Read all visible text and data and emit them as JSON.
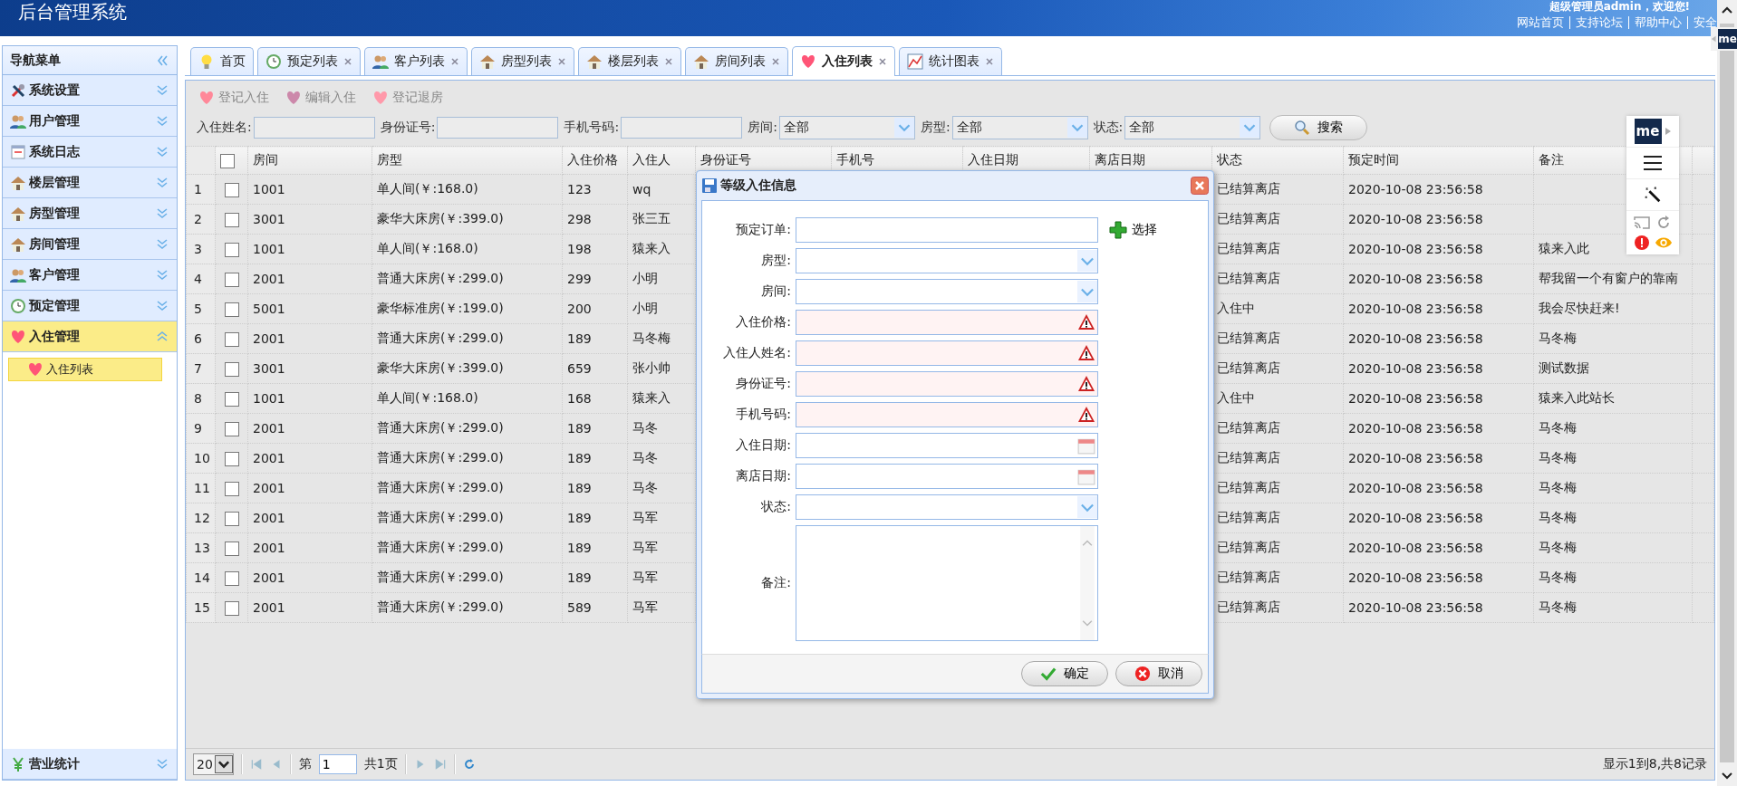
{
  "header": {
    "title": "后台管理系统",
    "welcome": "超级管理员admin，欢迎您!",
    "links": [
      "网站首页",
      "支持论坛",
      "帮助中心",
      "安全"
    ]
  },
  "sidebar": {
    "title": "导航菜单",
    "items": [
      {
        "label": "系统设置",
        "expanded": false
      },
      {
        "label": "用户管理",
        "expanded": false
      },
      {
        "label": "系统日志",
        "expanded": false
      },
      {
        "label": "楼层管理",
        "expanded": false
      },
      {
        "label": "房型管理",
        "expanded": false
      },
      {
        "label": "房间管理",
        "expanded": false
      },
      {
        "label": "客户管理",
        "expanded": false
      },
      {
        "label": "预定管理",
        "expanded": false
      },
      {
        "label": "入住管理",
        "expanded": true,
        "children": [
          {
            "label": "入住列表",
            "selected": true
          }
        ]
      }
    ],
    "bottom_item": {
      "label": "营业统计",
      "expanded": false
    }
  },
  "tabs": [
    {
      "label": "首页",
      "closable": false,
      "selected": false
    },
    {
      "label": "预定列表",
      "closable": true,
      "selected": false
    },
    {
      "label": "客户列表",
      "closable": true,
      "selected": false
    },
    {
      "label": "房型列表",
      "closable": true,
      "selected": false
    },
    {
      "label": "楼层列表",
      "closable": true,
      "selected": false
    },
    {
      "label": "房间列表",
      "closable": true,
      "selected": false
    },
    {
      "label": "入住列表",
      "closable": true,
      "selected": true
    },
    {
      "label": "统计图表",
      "closable": true,
      "selected": false
    }
  ],
  "toolbar": [
    {
      "label": "登记入住",
      "disabled": true
    },
    {
      "label": "编辑入住",
      "disabled": true
    },
    {
      "label": "登记退房",
      "disabled": true
    }
  ],
  "search": {
    "fields": [
      {
        "label": "入住姓名:",
        "kind": "text"
      },
      {
        "label": "身份证号:",
        "kind": "text"
      },
      {
        "label": "手机号码:",
        "kind": "text"
      },
      {
        "label": "房间:",
        "kind": "select",
        "value": "全部"
      },
      {
        "label": "房型:",
        "kind": "select",
        "value": "全部"
      },
      {
        "label": "状态:",
        "kind": "select",
        "value": "全部"
      }
    ],
    "button": "搜索"
  },
  "table": {
    "header_checked": false,
    "columns": [
      "房间",
      "房型",
      "入住价格",
      "入住人",
      "身份证号",
      "手机号",
      "入住日期",
      "离店日期",
      "状态",
      "预定时间",
      "备注"
    ],
    "rows": [
      {
        "number": "1",
        "checked": false,
        "cells": [
          "1001",
          "单人间(￥:168.0)",
          "123",
          "wq",
          "",
          "",
          "",
          "",
          "已结算离店",
          "2020-10-08 23:56:58",
          ""
        ]
      },
      {
        "number": "2",
        "checked": false,
        "cells": [
          "3001",
          "豪华大床房(￥:399.0)",
          "298",
          "张三五",
          "",
          "",
          "",
          "",
          "已结算离店",
          "2020-10-08 23:56:58",
          ""
        ]
      },
      {
        "number": "3",
        "checked": false,
        "cells": [
          "1001",
          "单人间(￥:168.0)",
          "198",
          "猿来入",
          "",
          "",
          "",
          "",
          "已结算离店",
          "2020-10-08 23:56:58",
          "猿来入此"
        ]
      },
      {
        "number": "4",
        "checked": false,
        "cells": [
          "2001",
          "普通大床房(￥:299.0)",
          "299",
          "小明",
          "",
          "",
          "",
          "",
          "已结算离店",
          "2020-10-08 23:56:58",
          "帮我留一个有窗户的靠南"
        ]
      },
      {
        "number": "5",
        "checked": false,
        "cells": [
          "5001",
          "豪华标准房(￥:199.0)",
          "200",
          "小明",
          "",
          "",
          "",
          "",
          "入住中",
          "2020-10-08 23:56:58",
          "我会尽快赶来!"
        ]
      },
      {
        "number": "6",
        "checked": false,
        "cells": [
          "2001",
          "普通大床房(￥:299.0)",
          "189",
          "马冬梅",
          "",
          "",
          "",
          "",
          "已结算离店",
          "2020-10-08 23:56:58",
          "马冬梅"
        ]
      },
      {
        "number": "7",
        "checked": false,
        "cells": [
          "3001",
          "豪华大床房(￥:399.0)",
          "659",
          "张小帅",
          "",
          "",
          "",
          "",
          "已结算离店",
          "2020-10-08 23:56:58",
          "测试数据"
        ]
      },
      {
        "number": "8",
        "checked": false,
        "cells": [
          "1001",
          "单人间(￥:168.0)",
          "168",
          "猿来入",
          "",
          "",
          "",
          "",
          "入住中",
          "2020-10-08 23:56:58",
          "猿来入此站长"
        ]
      },
      {
        "number": "9",
        "checked": false,
        "cells": [
          "2001",
          "普通大床房(￥:299.0)",
          "189",
          "马冬",
          "",
          "",
          "",
          "",
          "已结算离店",
          "2020-10-08 23:56:58",
          "马冬梅"
        ]
      },
      {
        "number": "10",
        "checked": false,
        "cells": [
          "2001",
          "普通大床房(￥:299.0)",
          "189",
          "马冬",
          "",
          "",
          "",
          "",
          "已结算离店",
          "2020-10-08 23:56:58",
          "马冬梅"
        ]
      },
      {
        "number": "11",
        "checked": false,
        "cells": [
          "2001",
          "普通大床房(￥:299.0)",
          "189",
          "马冬",
          "",
          "",
          "",
          "",
          "已结算离店",
          "2020-10-08 23:56:58",
          "马冬梅"
        ]
      },
      {
        "number": "12",
        "checked": false,
        "cells": [
          "2001",
          "普通大床房(￥:299.0)",
          "189",
          "马军",
          "",
          "",
          "",
          "",
          "已结算离店",
          "2020-10-08 23:56:58",
          "马冬梅"
        ]
      },
      {
        "number": "13",
        "checked": false,
        "cells": [
          "2001",
          "普通大床房(￥:299.0)",
          "189",
          "马军",
          "",
          "",
          "",
          "",
          "已结算离店",
          "2020-10-08 23:56:58",
          "马冬梅"
        ]
      },
      {
        "number": "14",
        "checked": false,
        "cells": [
          "2001",
          "普通大床房(￥:299.0)",
          "189",
          "马军",
          "",
          "",
          "",
          "",
          "已结算离店",
          "2020-10-08 23:56:58",
          "马冬梅"
        ]
      },
      {
        "number": "15",
        "checked": false,
        "cells": [
          "2001",
          "普通大床房(￥:299.0)",
          "589",
          "马军",
          "",
          "",
          "",
          "",
          "已结算离店",
          "2020-10-08 23:56:58",
          "马冬梅"
        ]
      }
    ]
  },
  "pagination": {
    "page_size": "20",
    "page_prefix": "第",
    "page": "1",
    "page_suffix": "共1页",
    "summary": "显示1到8,共8记录"
  },
  "dialog": {
    "title": "等级入住信息",
    "fields": [
      {
        "label": "预定订单:",
        "kind": "text"
      },
      {
        "label": "房型:",
        "kind": "select"
      },
      {
        "label": "房间:",
        "kind": "select"
      },
      {
        "label": "入住价格:",
        "kind": "required"
      },
      {
        "label": "入住人姓名:",
        "kind": "required"
      },
      {
        "label": "身份证号:",
        "kind": "required"
      },
      {
        "label": "手机号码:",
        "kind": "required"
      },
      {
        "label": "入住日期:",
        "kind": "date"
      },
      {
        "label": "离店日期:",
        "kind": "date"
      },
      {
        "label": "状态:",
        "kind": "select"
      },
      {
        "label": "备注:",
        "kind": "textarea"
      }
    ],
    "pick_button": "选择",
    "ok_button": "确定",
    "cancel_button": "取消"
  },
  "extension": {
    "logo": "me"
  },
  "extension_tab": {
    "logo": "me"
  }
}
